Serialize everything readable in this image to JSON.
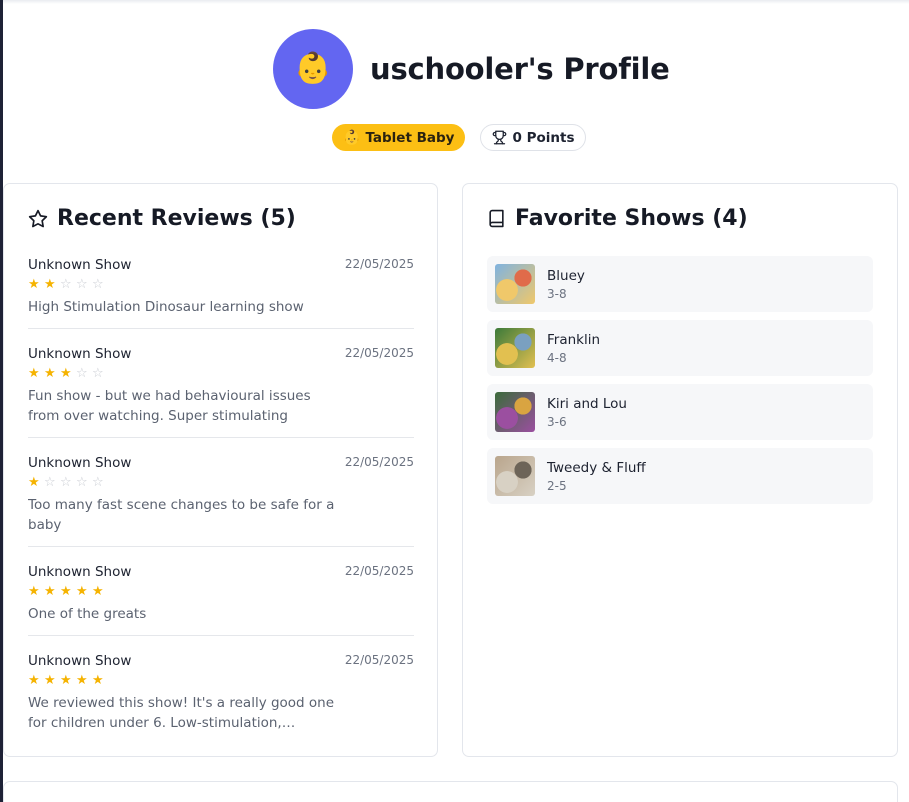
{
  "profile": {
    "avatar_emoji": "👶",
    "title": "uschooler's Profile",
    "level_badge": "Tablet Baby",
    "level_badge_emoji": "👶",
    "points_badge": "0 Points",
    "avatar_color": "#6366f1",
    "level_color": "#fcbf14"
  },
  "reviews": {
    "heading": "Recent Reviews (5)",
    "icon": "star-outline-icon",
    "items": [
      {
        "show": "Unknown Show",
        "date": "22/05/2025",
        "rating": 2,
        "text": "High Stimulation Dinosaur learning show"
      },
      {
        "show": "Unknown Show",
        "date": "22/05/2025",
        "rating": 3,
        "text": "Fun show - but we had behavioural issues from over watching. Super stimulating"
      },
      {
        "show": "Unknown Show",
        "date": "22/05/2025",
        "rating": 1,
        "text": "Too many fast scene changes to be safe for a baby"
      },
      {
        "show": "Unknown Show",
        "date": "22/05/2025",
        "rating": 5,
        "text": "One of the greats"
      },
      {
        "show": "Unknown Show",
        "date": "22/05/2025",
        "rating": 5,
        "text": "We reviewed this show! It's a really good one for children under 6. Low-stimulation, promoting..."
      }
    ]
  },
  "favorites": {
    "heading": "Favorite Shows (4)",
    "icon": "book-icon",
    "items": [
      {
        "name": "Bluey",
        "age": "3-8",
        "thumb_colors": [
          "#7fb3e0",
          "#f0c86a",
          "#e06b4a"
        ]
      },
      {
        "name": "Franklin",
        "age": "4-8",
        "thumb_colors": [
          "#3c7a3a",
          "#e2c050",
          "#7aa0c0"
        ]
      },
      {
        "name": "Kiri and Lou",
        "age": "3-6",
        "thumb_colors": [
          "#3b6b3b",
          "#9b4fa0",
          "#d9a441"
        ]
      },
      {
        "name": "Tweedy & Fluff",
        "age": "2-5",
        "thumb_colors": [
          "#b9a58c",
          "#d8d1c4",
          "#6d6458"
        ]
      }
    ]
  },
  "colors": {
    "star_on": "#f5b301",
    "star_off": "#c9ccd3"
  }
}
